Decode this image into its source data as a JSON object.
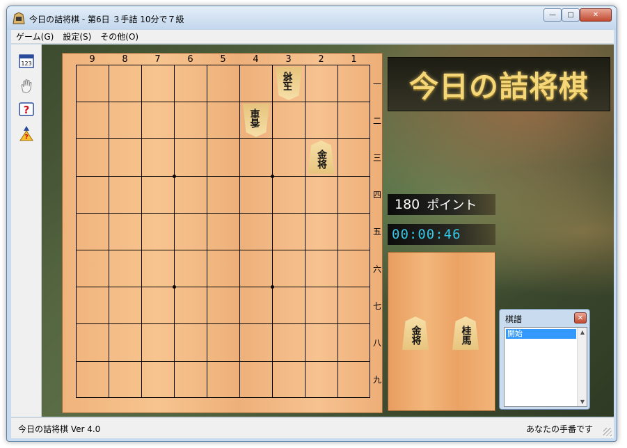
{
  "window": {
    "title": "今日の詰将棋 - 第6日 ３手詰 10分で７級",
    "buttons": {
      "minimize": "—",
      "maximize": "□",
      "close": "✕"
    }
  },
  "menu": [
    "ゲーム(G)",
    "設定(S)",
    "その他(O)"
  ],
  "toolbar": [
    {
      "name": "calendar-icon",
      "glyph": "123"
    },
    {
      "name": "hand-icon",
      "glyph": "✋"
    },
    {
      "name": "hint-icon",
      "glyph": "?"
    },
    {
      "name": "answer-icon",
      "glyph": "?"
    }
  ],
  "board": {
    "files": [
      "9",
      "8",
      "7",
      "6",
      "5",
      "4",
      "3",
      "2",
      "1"
    ],
    "ranks": [
      "一",
      "二",
      "三",
      "四",
      "五",
      "六",
      "七",
      "八",
      "九"
    ],
    "pieces": [
      {
        "file": 3,
        "rank": 1,
        "label": "玉将",
        "orientation": "reversed"
      },
      {
        "file": 4,
        "rank": 2,
        "label": "香車",
        "orientation": "reversed"
      },
      {
        "file": 2,
        "rank": 3,
        "label": "金将",
        "orientation": "upright"
      }
    ]
  },
  "logo": "今日の詰将棋",
  "score": {
    "value": "180",
    "unit": "ポイント"
  },
  "timer": "00:00:46",
  "in_hand": [
    {
      "label": "金将"
    },
    {
      "label": "桂馬"
    }
  ],
  "kifu": {
    "title": "棋譜",
    "close": "✕",
    "moves": [
      "開始"
    ]
  },
  "status": {
    "left": "今日の詰将棋 Ver 4.0",
    "right": "あなたの手番です"
  }
}
